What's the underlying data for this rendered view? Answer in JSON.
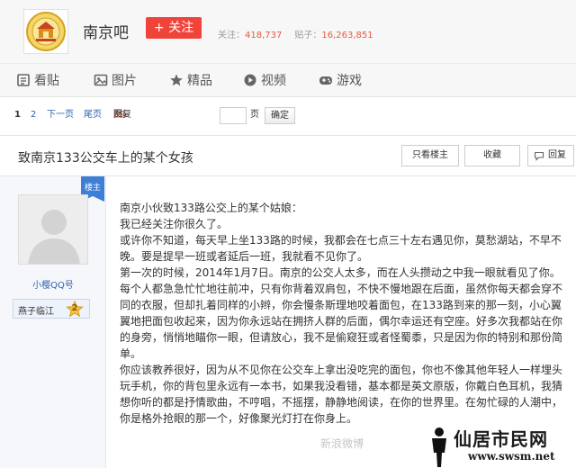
{
  "header": {
    "forum_name": "南京吧",
    "follow_label": "+ 关注",
    "follow_prefix": "关注：",
    "follow_count": "418,737",
    "posts_prefix": "贴子：",
    "posts_count": "16,263,851"
  },
  "nav": {
    "items": [
      {
        "label": "看贴",
        "icon": "post-icon"
      },
      {
        "label": "图片",
        "icon": "image-icon"
      },
      {
        "label": "精品",
        "icon": "star-icon"
      },
      {
        "label": "视频",
        "icon": "video-icon"
      },
      {
        "label": "游戏",
        "icon": "gamepad-icon"
      }
    ]
  },
  "pager": {
    "current": "1",
    "page2": "2",
    "next": "下一页",
    "last": "尾页",
    "reply_count": "39",
    "reply_suffix": "回复贴，共",
    "total_pages": "2",
    "total_suffix": "页，跳到",
    "page_unit": "页",
    "confirm": "确定"
  },
  "thread": {
    "title": "致南京133公交车上的某个女孩",
    "only_op": "只看楼主",
    "favorite": "收藏",
    "reply": "回复"
  },
  "author": {
    "badge": "楼主",
    "username": "小樱QQ号",
    "level_name": "燕子临江",
    "level_num": "2"
  },
  "post": {
    "paragraphs": [
      "南京小伙致133路公交上的某个姑娘：",
      "我已经关注你很久了。",
      "或许你不知道，每天早上坐133路的时候，我都会在七点三十左右遇见你，莫愁湖站，不早不晚。要是提早一班或者延后一班，我就看不见你了。",
      "第一次的时候，2014年1月7日。南京的公交人太多，而在人头攒动之中我一眼就看见了你。每个人都急急忙忙地往前冲，只有你背着双肩包，不快不慢地跟在后面，虽然你每天都会穿不同的衣服，但却扎着同样的小辫，你会慢条斯理地咬着面包，在133路到来的那一刻，小心翼翼地把面包收起来，因为你永远站在拥挤人群的后面，偶尔幸运还有空座。好多次我都站在你的身旁，悄悄地瞄你一眼，但请放心，我不是偷窥狂或者怪蜀黍，只是因为你的特别和那份简单。",
      "你应该教养很好，因为从不见你在公交车上拿出没吃完的面包，你也不像其他年轻人一样埋头玩手机，你的背包里永远有一本书，如果我没看错，基本都是英文原版，你戴白色耳机，我猜想你听的都是抒情歌曲，不哼唱，不摇摆，静静地阅读，在你的世界里。在匆忙碌的人潮中，你是格外抢眼的那一个，好像聚光灯打在你身上。"
    ]
  },
  "watermark": {
    "left_text": "新浪微博",
    "site_name": "仙居市民网",
    "url": "www.swsm.net"
  },
  "colors": {
    "accent_red": "#f0443a",
    "link_blue": "#2d64b3",
    "stat_orange": "#e75a3c",
    "badge_blue": "#3d7fd6"
  }
}
